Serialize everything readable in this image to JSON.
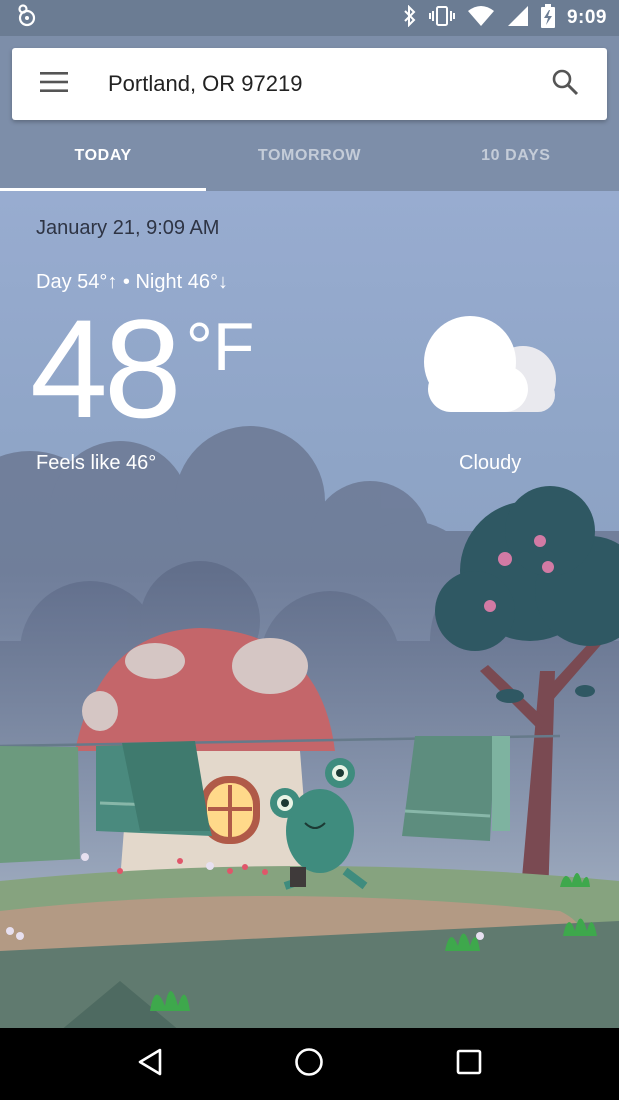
{
  "status_bar": {
    "time": "9:09",
    "icons": [
      "notification-icon",
      "bluetooth-icon",
      "vibrate-icon",
      "wifi-icon",
      "signal-icon",
      "battery-charging-icon"
    ]
  },
  "search": {
    "location": "Portland, OR 97219",
    "menu_icon": "menu-icon",
    "search_icon": "search-icon"
  },
  "tabs": [
    {
      "label": "TODAY",
      "active": true
    },
    {
      "label": "TOMORROW",
      "active": false
    },
    {
      "label": "10 DAYS",
      "active": false
    }
  ],
  "weather": {
    "date": "January 21, 9:09 AM",
    "day_night": "Day 54°↑ • Night 46°↓",
    "temperature": "48",
    "unit": "°F",
    "feels_like": "Feels like 46°",
    "condition": "Cloudy",
    "condition_icon": "cloud-icon"
  },
  "nav": {
    "back_icon": "back-icon",
    "home_icon": "home-icon",
    "recents_icon": "recents-icon"
  },
  "colors": {
    "status_bar": "#6b7c93",
    "header": "#7d8ea9",
    "sky": "#98acd0"
  }
}
